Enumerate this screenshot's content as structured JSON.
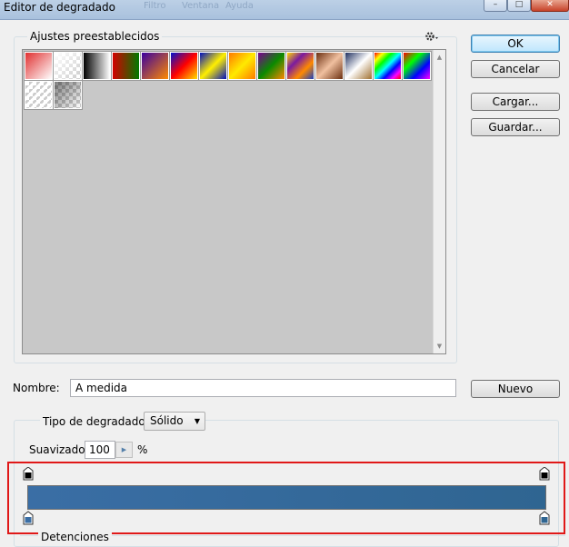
{
  "window": {
    "title": "Editor de degradado",
    "faded_menu": [
      "Filtro",
      "Ventana",
      "Ayuda"
    ],
    "controls": {
      "minimize": "–",
      "maximize": "□",
      "close": "✕"
    }
  },
  "presets": {
    "legend": "Ajustes preestablecidos",
    "menu_icon": "gear-icon",
    "swatches": [
      {
        "name": "preset-fg-to-bg",
        "css": "linear-gradient(135deg,#e03030 0%,#ffffff 100%)"
      },
      {
        "name": "preset-fg-to-transparent",
        "css": "linear-gradient(135deg,#ffffff 0%,rgba(255,255,255,0) 100%)",
        "checker": true
      },
      {
        "name": "preset-black-white",
        "css": "linear-gradient(90deg,#000000,#ffffff)"
      },
      {
        "name": "preset-red-green",
        "css": "linear-gradient(90deg,#d40000,#007a00)"
      },
      {
        "name": "preset-violet-orange",
        "css": "linear-gradient(135deg,#3a00a0,#ff8a00)"
      },
      {
        "name": "preset-blue-red-yellow",
        "css": "linear-gradient(135deg,#0010d0,#ff0000 50%,#ffe000)"
      },
      {
        "name": "preset-blue-yellow-blue",
        "css": "linear-gradient(135deg,#0010c0,#fff000 50%,#0010c0)"
      },
      {
        "name": "preset-orange-yellow-orange",
        "css": "linear-gradient(135deg,#ff7a00,#ffea00 50%,#ff7a00)"
      },
      {
        "name": "preset-violet-green-orange",
        "css": "linear-gradient(135deg,#7a0090,#0a8a00 50%,#ff8800)"
      },
      {
        "name": "preset-yellow-violet-orange-blue",
        "css": "linear-gradient(135deg,#ffd800,#7a1aa0 33%,#ff8a00 66%,#1a40c0)"
      },
      {
        "name": "preset-copper",
        "css": "linear-gradient(135deg,#6b2f10,#f0c0a0 50%,#6b2f10)"
      },
      {
        "name": "preset-chrome",
        "css": "linear-gradient(135deg,#203060,#ffffff 50%,#a07030)"
      },
      {
        "name": "preset-spectrum",
        "css": "linear-gradient(135deg,#ff0000,#ffff00,#00ff00,#00ffff,#0000ff,#ff00ff,#ff0000)"
      },
      {
        "name": "preset-transparent-rainbow",
        "css": "linear-gradient(135deg,#ff0000,#00ff00,#0000ff,#ff00ff)",
        "checker": true
      },
      {
        "name": "preset-transparent-stripes",
        "css": "repeating-linear-gradient(135deg,#ffffff 0,#ffffff 3px,rgba(255,255,255,0) 3px,rgba(255,255,255,0) 6px)",
        "checker": true
      },
      {
        "name": "preset-neutral-density",
        "css": "linear-gradient(135deg,rgba(0,0,0,0.5),rgba(0,0,0,0))",
        "checker": true
      }
    ]
  },
  "buttons": {
    "ok": "OK",
    "cancel": "Cancelar",
    "load": "Cargar...",
    "save": "Guardar...",
    "new": "Nuevo"
  },
  "name_field": {
    "label": "Nombre:",
    "value": "A medida"
  },
  "gradient_type": {
    "label": "Tipo de degradado:",
    "value": "Sólido"
  },
  "smoothness": {
    "label": "Suavizado:",
    "value": "100",
    "unit": "%"
  },
  "gradient": {
    "start_color": "#3a6ea5",
    "end_color": "#2f6591"
  },
  "stops_legend": "Detenciones"
}
